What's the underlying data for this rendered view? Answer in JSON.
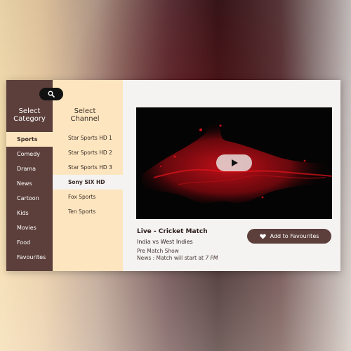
{
  "search": {
    "icon": "search-icon"
  },
  "categories": {
    "title_line1": "Select",
    "title_line2": "Category",
    "items": [
      {
        "label": "Sports",
        "active": true
      },
      {
        "label": "Comedy"
      },
      {
        "label": "Drama"
      },
      {
        "label": "News"
      },
      {
        "label": "Cartoon"
      },
      {
        "label": "Kids"
      },
      {
        "label": "Movies"
      },
      {
        "label": "Food"
      },
      {
        "label": "Favourites"
      }
    ]
  },
  "channels": {
    "title_line1": "Select",
    "title_line2": "Channel",
    "items": [
      {
        "label": "Star Sports HD 1"
      },
      {
        "label": "Star Sports HD 2"
      },
      {
        "label": "Star Sports HD 3"
      },
      {
        "label": "Sony SIX HD",
        "active": true
      },
      {
        "label": "Fox Sports"
      },
      {
        "label": "Ten Sports"
      }
    ]
  },
  "player": {
    "play_icon": "play-icon",
    "title": "Live - Cricket Match",
    "subtitle": "India vs West Indies",
    "pre_show": "Pre Match Show",
    "news_prefix": "News : Match will start at ",
    "news_time": "7 PM"
  },
  "favourite_button": {
    "label": "Add to Favourites",
    "icon": "heart-icon"
  },
  "colors": {
    "panel_dark": "#5c3f3b",
    "panel_light": "#fde6bf",
    "content_bg": "#f4f3f1"
  }
}
